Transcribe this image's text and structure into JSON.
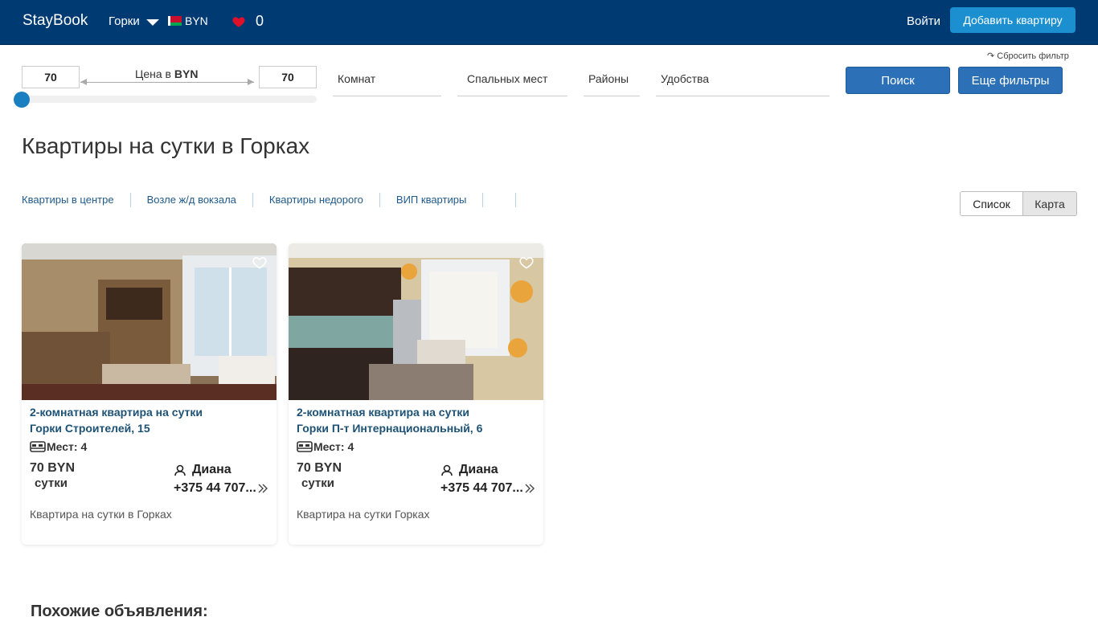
{
  "header": {
    "logo": "StayBook",
    "city": "Горки",
    "currency": "BYN",
    "favorites_count": "0",
    "login": "Войти",
    "add_apartment": "Добавить квартиру"
  },
  "filters": {
    "reset": "↷ Сбросить фильтр",
    "price_min": "70",
    "price_max": "70",
    "price_label_prefix": "Цена в ",
    "price_label_currency": "BYN",
    "price_slider_fraction": 0,
    "rooms": "Комнат",
    "beds": "Спальных мест",
    "districts": "Районы",
    "amenities": "Удобства",
    "search": "Поиск",
    "more_filters": "Еще фильтры"
  },
  "page_title": "Квартиры на сутки в Горках",
  "quick_links": [
    "Квартиры в центре",
    "Возле ж/д вокзала",
    "Квартиры недорого",
    "ВИП квартиры"
  ],
  "view_toggle": {
    "list": "Список",
    "map": "Карта"
  },
  "cards": [
    {
      "title_line1": "2-комнатная квартира на сутки",
      "title_line2": "Горки Строителей, 15",
      "places": "Мест: 4",
      "price": "70 BYN",
      "period": "сутки",
      "owner": "Диана",
      "phone": "+375 44 707...",
      "description": "Квартира на сутки в Горках"
    },
    {
      "title_line1": "2-комнатная квартира на сутки",
      "title_line2": "Горки П-т Интернациональный, 6",
      "places": "Мест: 4",
      "price": "70 BYN",
      "period": "сутки",
      "owner": "Диана",
      "phone": "+375 44 707...",
      "description": "Квартира на сутки Горках"
    }
  ],
  "similar_heading": "Похожие объявления:",
  "colors": {
    "header_bg": "#003a73",
    "accent_blue": "#2c71b8",
    "add_button": "#1b8fd0",
    "heart": "#e0102a"
  }
}
